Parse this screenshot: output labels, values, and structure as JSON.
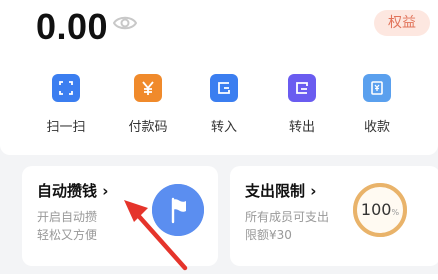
{
  "balance": {
    "amount": "0.00",
    "badge_label": "权益"
  },
  "actions": [
    {
      "label": "扫一扫",
      "icon": "scan-icon",
      "color": "#3b7ef0"
    },
    {
      "label": "付款码",
      "icon": "yuan-icon",
      "color": "#f08a2b"
    },
    {
      "label": "转入",
      "icon": "transfer-in-icon",
      "color": "#3b7ef0"
    },
    {
      "label": "转出",
      "icon": "transfer-out-icon",
      "color": "#6a5cf0"
    },
    {
      "label": "收款",
      "icon": "receive-icon",
      "color": "#5aa0ee"
    }
  ],
  "auto_save": {
    "title": "自动攒钱",
    "line1": "开启自动攒",
    "line2": "轻松又方便",
    "icon": "flag-icon"
  },
  "spend_limit": {
    "title": "支出限制",
    "line1": "所有成员可支出",
    "line2": "限额¥30",
    "percent": "100",
    "percent_unit": "%",
    "ring_color": "#e9b36a"
  },
  "colors": {
    "annotation_arrow": "#e5342b",
    "badge_bg": "#fde7e0",
    "badge_text": "#e1735a"
  }
}
